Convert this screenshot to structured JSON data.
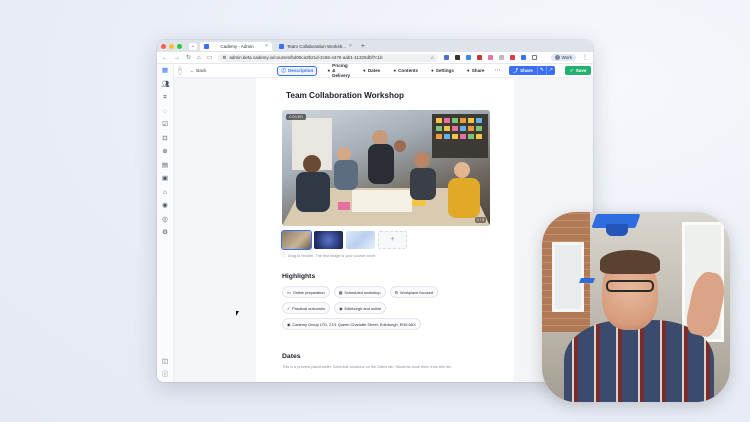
{
  "browser": {
    "tabs": [
      {
        "title": "Cademy - Admin",
        "active": true
      },
      {
        "title": "Team Collaboration Worksh...",
        "active": false
      }
    ],
    "url": "admin.beta.cademy.io/courses/bd05ca3b21d-2c65-4476-aab1-11326dbf7c1b",
    "profile_label": "Work"
  },
  "topnav": {
    "back_label": "Back",
    "tabs": [
      {
        "label": "Description",
        "icon": "info-icon",
        "active": true
      },
      {
        "label": "Pricing & Delivery",
        "icon": "price-icon",
        "active": false
      },
      {
        "label": "Dates",
        "icon": "calendar-icon",
        "active": false
      },
      {
        "label": "Contents",
        "icon": "list-icon",
        "active": false
      },
      {
        "label": "Settings",
        "icon": "gear-icon",
        "active": false
      },
      {
        "label": "Share",
        "icon": "share-icon",
        "active": false
      }
    ],
    "share_button": "Share",
    "save_button": "Save"
  },
  "course": {
    "title": "Team Collaboration Workshop",
    "cover_badge": "COVER",
    "cover_counter": "1 / 3",
    "reorder_hint": "Drag to reorder. The first image is your course cover.",
    "add_image_glyph": "+"
  },
  "highlights": {
    "heading": "Highlights",
    "chips": [
      {
        "label": "Online preparation",
        "icon": "laptop-icon"
      },
      {
        "label": "Scheduled workshop",
        "icon": "calendar-icon"
      },
      {
        "label": "Workplace focused",
        "icon": "gear-icon"
      },
      {
        "label": "Practical outcomes",
        "icon": "check-icon"
      },
      {
        "label": "Edinburgh and online",
        "icon": "location-icon"
      },
      {
        "label": "Cademy Group LTD, 27/1 Queen Charlotte Street, Edinburgh, EH6 6AX",
        "icon": "location-icon"
      }
    ]
  },
  "dates": {
    "heading": "Dates",
    "note": "This is a preview placeholder. Schedule sessions on the Dates tab. Students book them from this list."
  },
  "colors": {
    "accent": "#3a6ff7",
    "save": "#23b26d"
  }
}
